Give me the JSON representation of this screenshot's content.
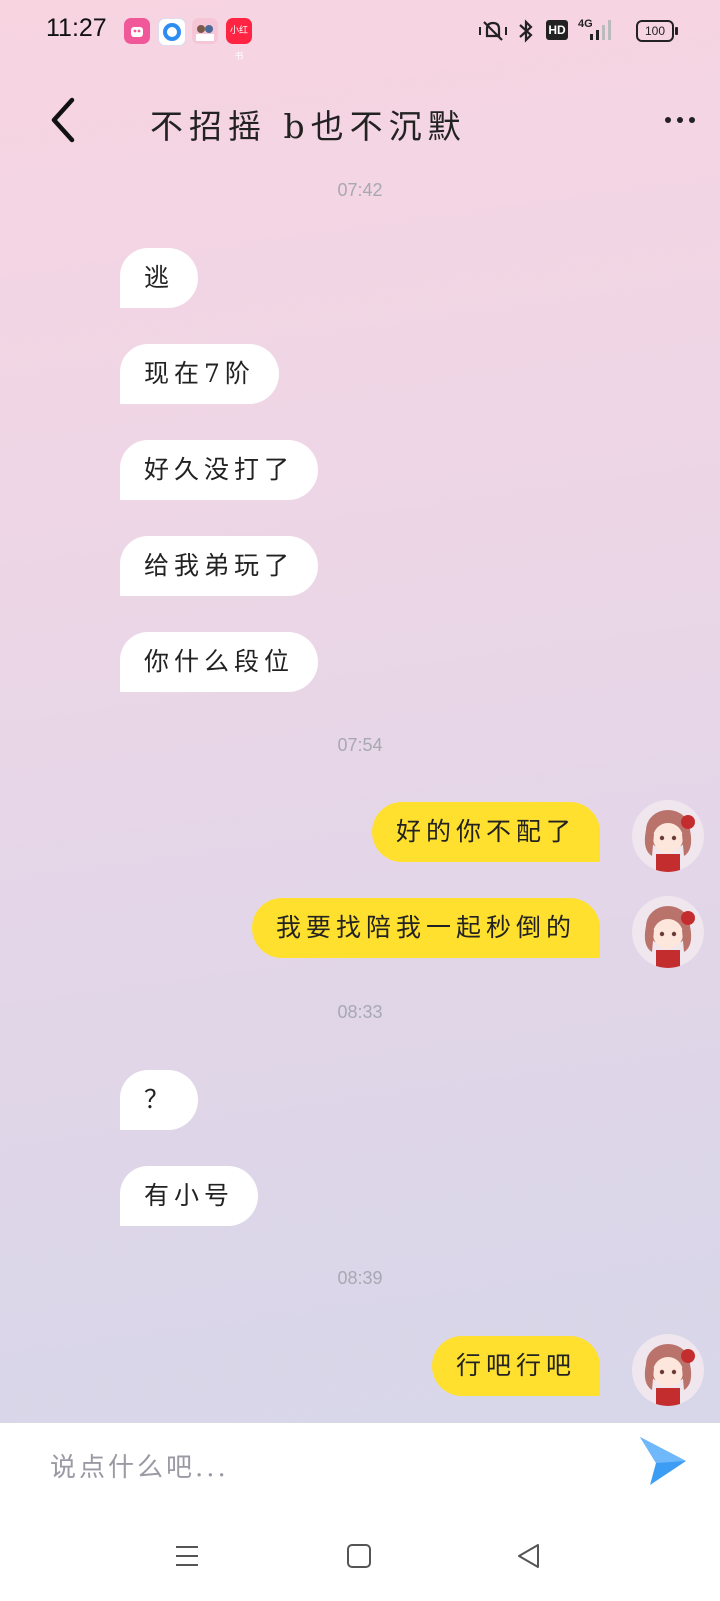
{
  "status_bar": {
    "time": "11:27",
    "apps": [
      {
        "icon": "pink-app-icon",
        "color": "#f0589a",
        "label": ""
      },
      {
        "icon": "blue-ring-app-icon",
        "color": "#2d8cf0",
        "label": ""
      },
      {
        "icon": "photo-app-icon",
        "color": "#f2a6c0",
        "label": ""
      },
      {
        "icon": "xiaohongshu-icon",
        "color": "#ff2442",
        "label": "小红书"
      }
    ],
    "network": "4G",
    "hd": "HD",
    "battery": "100"
  },
  "header": {
    "title": "不招摇 b也不沉默"
  },
  "messages": [
    {
      "type": "time",
      "text": "07:42"
    },
    {
      "type": "in",
      "text": "逃"
    },
    {
      "type": "in",
      "text": "现在7阶"
    },
    {
      "type": "in",
      "text": "好久没打了"
    },
    {
      "type": "in",
      "text": "给我弟玩了"
    },
    {
      "type": "in",
      "text": "你什么段位"
    },
    {
      "type": "time",
      "text": "07:54"
    },
    {
      "type": "out",
      "text": "好的你不配了"
    },
    {
      "type": "out",
      "text": "我要找陪我一起秒倒的"
    },
    {
      "type": "time",
      "text": "08:33"
    },
    {
      "type": "in",
      "text": "？"
    },
    {
      "type": "in",
      "text": "有小号"
    },
    {
      "type": "time",
      "text": "08:39"
    },
    {
      "type": "out",
      "text": "行吧行吧"
    }
  ],
  "input": {
    "placeholder": "说点什么吧..."
  },
  "colors": {
    "outgoing_bubble": "#ffe02e",
    "incoming_bubble": "#ffffff",
    "send_button": "#3d9df5"
  }
}
